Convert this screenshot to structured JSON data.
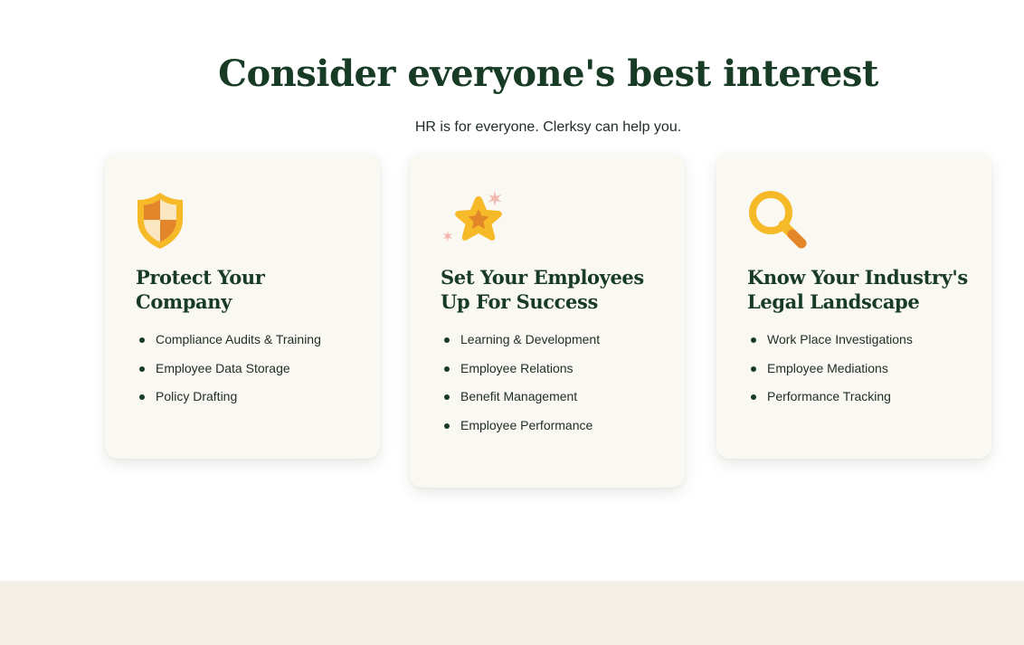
{
  "section": {
    "headline": "Consider everyone's best interest",
    "subhead": "HR is for everyone. Clerksy can help you."
  },
  "cards": [
    {
      "icon": "shield-icon",
      "title_line1": "Protect Your",
      "title_line2": "Company",
      "items": [
        "Compliance Audits & Training",
        "Employee Data Storage",
        "Policy Drafting"
      ]
    },
    {
      "icon": "star-icon",
      "title_line1": "Set Your Employees",
      "title_line2": "Up For Success",
      "items": [
        "Learning & Development",
        "Employee Relations",
        "Benefit Management",
        "Employee Performance"
      ]
    },
    {
      "icon": "magnifying-glass-icon",
      "title_line1": "Know Your Industry's",
      "title_line2": "Legal Landscape",
      "items": [
        "Work Place Investigations",
        "Employee Mediations",
        "Performance Tracking"
      ]
    }
  ],
  "colors": {
    "heading": "#183b25",
    "text": "#1f2d24",
    "card_bg": "#faf8f3",
    "accent_yellow": "#f6b928",
    "accent_orange": "#e3862a",
    "sparkle_pink": "#f3b8b0",
    "footer_band": "#f3efe6"
  }
}
